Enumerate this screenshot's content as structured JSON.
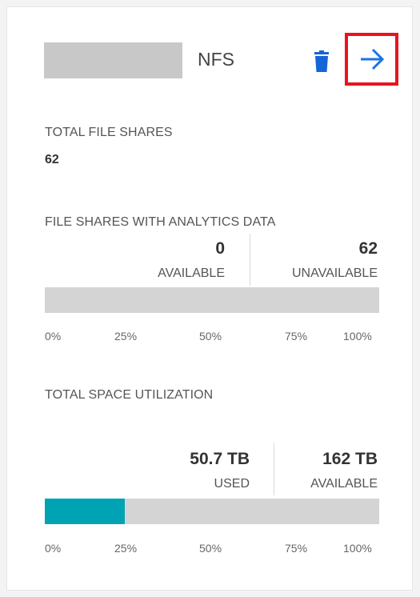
{
  "header": {
    "protocol": "NFS",
    "delete_icon": "trash-icon",
    "open_icon": "arrow-right-icon",
    "accent_color": "#1a73e8",
    "highlight_color": "#e8141e"
  },
  "total_file_shares": {
    "label": "TOTAL FILE SHARES",
    "value": "62"
  },
  "analytics": {
    "label": "FILE SHARES WITH ANALYTICS DATA",
    "available_value": "0",
    "available_label": "AVAILABLE",
    "unavailable_value": "62",
    "unavailable_label": "UNAVAILABLE",
    "available_fraction": 0,
    "ticks": [
      "0%",
      "25%",
      "50%",
      "75%",
      "100%"
    ]
  },
  "space": {
    "label": "TOTAL SPACE UTILIZATION",
    "used_value": "50.7 TB",
    "used_label": "USED",
    "available_value": "162 TB",
    "available_label": "AVAILABLE",
    "used_fraction": 0.24,
    "fill_color": "#00a3b4",
    "ticks": [
      "0%",
      "25%",
      "50%",
      "75%",
      "100%"
    ]
  }
}
